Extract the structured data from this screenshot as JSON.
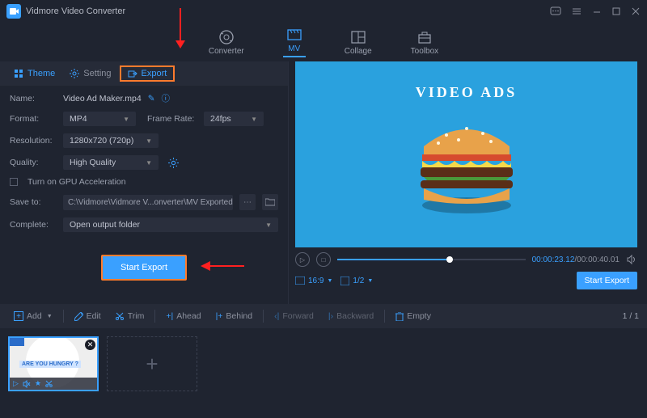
{
  "titlebar": {
    "title": "Vidmore Video Converter"
  },
  "maintabs": {
    "converter": "Converter",
    "mv": "MV",
    "collage": "Collage",
    "toolbox": "Toolbox"
  },
  "subtabs": {
    "theme": "Theme",
    "setting": "Setting",
    "export": "Export"
  },
  "form": {
    "name_lbl": "Name:",
    "name_val": "Video Ad Maker.mp4",
    "format_lbl": "Format:",
    "format_val": "MP4",
    "framerate_lbl": "Frame Rate:",
    "framerate_val": "24fps",
    "resolution_lbl": "Resolution:",
    "resolution_val": "1280x720 (720p)",
    "quality_lbl": "Quality:",
    "quality_val": "High Quality",
    "gpu_lbl": "Turn on GPU Acceleration",
    "save_lbl": "Save to:",
    "save_val": "C:\\Vidmore\\Vidmore V...onverter\\MV Exported",
    "complete_lbl": "Complete:",
    "complete_val": "Open output folder",
    "start_export": "Start Export"
  },
  "preview": {
    "title": "VIDEO ADS"
  },
  "playback": {
    "time_current": "00:00:23.12",
    "time_total": "/00:00:40.01",
    "aspect": "16:9",
    "scale": "1/2"
  },
  "start_export_right": "Start Export",
  "toolbar": {
    "add": "Add",
    "edit": "Edit",
    "trim": "Trim",
    "ahead": "Ahead",
    "behind": "Behind",
    "forward": "Forward",
    "backward": "Backward",
    "empty": "Empty",
    "pager": "1 / 1"
  },
  "thumb": {
    "hungry": "ARE YOU HUNGRY ?"
  }
}
